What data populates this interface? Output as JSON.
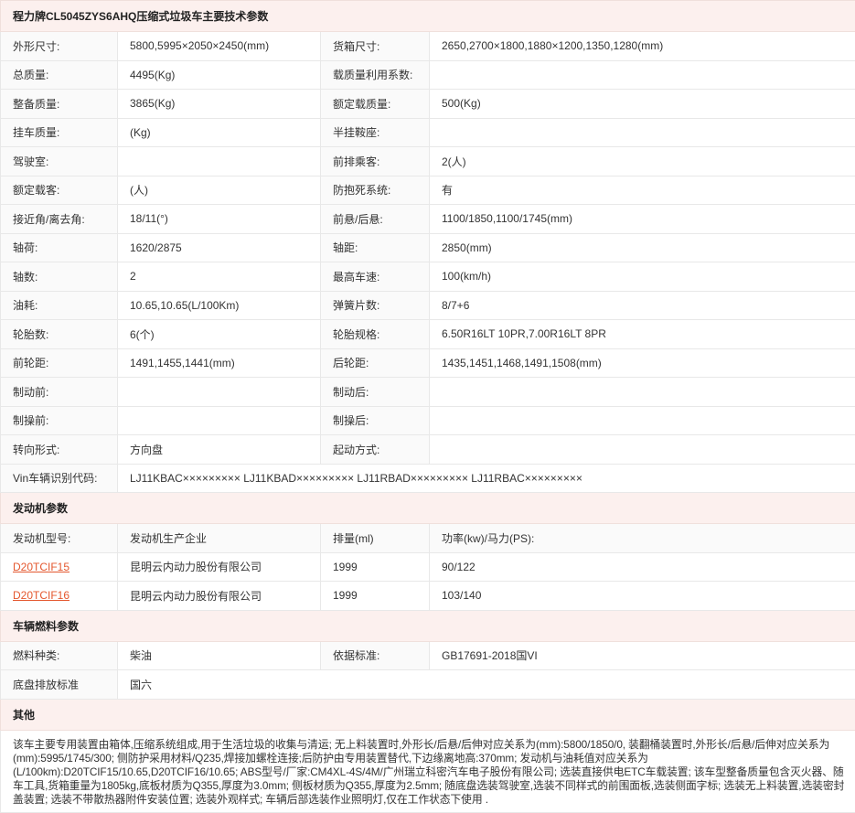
{
  "title": "程力牌CL5045ZYS6AHQ压缩式垃圾车主要技术参数",
  "specs": [
    [
      "外形尺寸:",
      "5800,5995×2050×2450(mm)",
      "货箱尺寸:",
      "2650,2700×1800,1880×1200,1350,1280(mm)"
    ],
    [
      "总质量:",
      "4495(Kg)",
      "载质量利用系数:",
      ""
    ],
    [
      "整备质量:",
      "3865(Kg)",
      "额定载质量:",
      "500(Kg)"
    ],
    [
      "挂车质量:",
      "(Kg)",
      "半挂鞍座:",
      ""
    ],
    [
      "驾驶室:",
      "",
      "前排乘客:",
      "2(人)"
    ],
    [
      "额定载客:",
      "(人)",
      "防抱死系统:",
      "有"
    ],
    [
      "接近角/离去角:",
      "18/11(°)",
      "前悬/后悬:",
      "1100/1850,1100/1745(mm)"
    ],
    [
      "轴荷:",
      "1620/2875",
      "轴距:",
      "2850(mm)"
    ],
    [
      "轴数:",
      "2",
      "最高车速:",
      "100(km/h)"
    ],
    [
      "油耗:",
      "10.65,10.65(L/100Km)",
      "弹簧片数:",
      "8/7+6"
    ],
    [
      "轮胎数:",
      "6(个)",
      "轮胎规格:",
      "6.50R16LT 10PR,7.00R16LT 8PR"
    ],
    [
      "前轮距:",
      "1491,1455,1441(mm)",
      "后轮距:",
      "1435,1451,1468,1491,1508(mm)"
    ],
    [
      "制动前:",
      "",
      "制动后:",
      ""
    ],
    [
      "制操前:",
      "",
      "制操后:",
      ""
    ],
    [
      "转向形式:",
      "方向盘",
      "起动方式:",
      ""
    ]
  ],
  "vin": {
    "label": "Vin车辆识别代码:",
    "value": "LJ11KBAC××××××××× LJ11KBAD××××××××× LJ11RBAD××××××××× LJ11RBAC×××××××××"
  },
  "engine": {
    "section_title": "发动机参数",
    "headers": [
      "发动机型号:",
      "发动机生产企业",
      "排量(ml)",
      "功率(kw)/马力(PS):"
    ],
    "rows": [
      [
        "D20TCIF15",
        "昆明云内动力股份有限公司",
        "1999",
        "90/122"
      ],
      [
        "D20TCIF16",
        "昆明云内动力股份有限公司",
        "1999",
        "103/140"
      ]
    ]
  },
  "fuel": {
    "section_title": "车辆燃料参数",
    "fuel_type_label": "燃料种类:",
    "fuel_type_value": "柴油",
    "standard_label": "依据标准:",
    "standard_value": "GB17691-2018国VI",
    "emission_label": "底盘排放标准",
    "emission_value": "国六"
  },
  "other": {
    "section_title": "其他",
    "notes": "该车主要专用装置由箱体,压缩系统组成,用于生活垃圾的收集与清运; 无上料装置时,外形长/后悬/后伸对应关系为(mm):5800/1850/0, 装翻桶装置时,外形长/后悬/后伸对应关系为(mm):5995/1745/300; 侧防护采用材料/Q235,焊接加螺栓连接;后防护由专用装置替代,下边缘离地高:370mm; 发动机与油耗值对应关系为(L/100km):D20TCIF15/10.65,D20TCIF16/10.65; ABS型号/厂家:CM4XL-4S/4M/广州瑞立科密汽车电子股份有限公司; 选装直接供电ETC车载装置; 该车型整备质量包含灭火器、随车工具,货箱重量为1805kg,底板材质为Q355,厚度为3.0mm; 侧板材质为Q355,厚度为2.5mm; 随底盘选装驾驶室,选装不同样式的前围面板,选装侧面字标; 选装无上料装置,选装密封盖装置; 选装不带散热器附件安装位置; 选装外观样式; 车辆后部选装作业照明灯,仅在工作状态下使用 ."
  }
}
